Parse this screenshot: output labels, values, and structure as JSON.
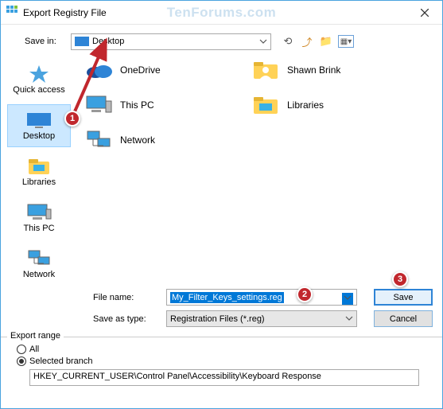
{
  "window": {
    "title": "Export Registry File",
    "watermark": "TenForums.com"
  },
  "savein": {
    "label": "Save in:",
    "value": "Desktop"
  },
  "toolbar_icons": [
    "back-icon",
    "up-icon",
    "newfolder-icon",
    "views-icon"
  ],
  "places": [
    {
      "key": "quickaccess",
      "label": "Quick access"
    },
    {
      "key": "desktop",
      "label": "Desktop",
      "selected": true
    },
    {
      "key": "libraries",
      "label": "Libraries"
    },
    {
      "key": "thispc",
      "label": "This PC"
    },
    {
      "key": "network",
      "label": "Network"
    }
  ],
  "files": [
    {
      "key": "onedrive",
      "label": "OneDrive"
    },
    {
      "key": "shawn",
      "label": "Shawn Brink"
    },
    {
      "key": "thispc",
      "label": "This PC"
    },
    {
      "key": "libraries",
      "label": "Libraries"
    },
    {
      "key": "network",
      "label": "Network"
    }
  ],
  "filename": {
    "label": "File name:",
    "value": "My_Filter_Keys_settings.reg"
  },
  "saveastype": {
    "label": "Save as type:",
    "value": "Registration Files (*.reg)"
  },
  "buttons": {
    "save": "Save",
    "cancel": "Cancel"
  },
  "export_range": {
    "legend": "Export range",
    "all": "All",
    "selected": "Selected branch",
    "branch": "HKEY_CURRENT_USER\\Control Panel\\Accessibility\\Keyboard Response"
  },
  "annotations": {
    "b1": "1",
    "b2": "2",
    "b3": "3"
  }
}
